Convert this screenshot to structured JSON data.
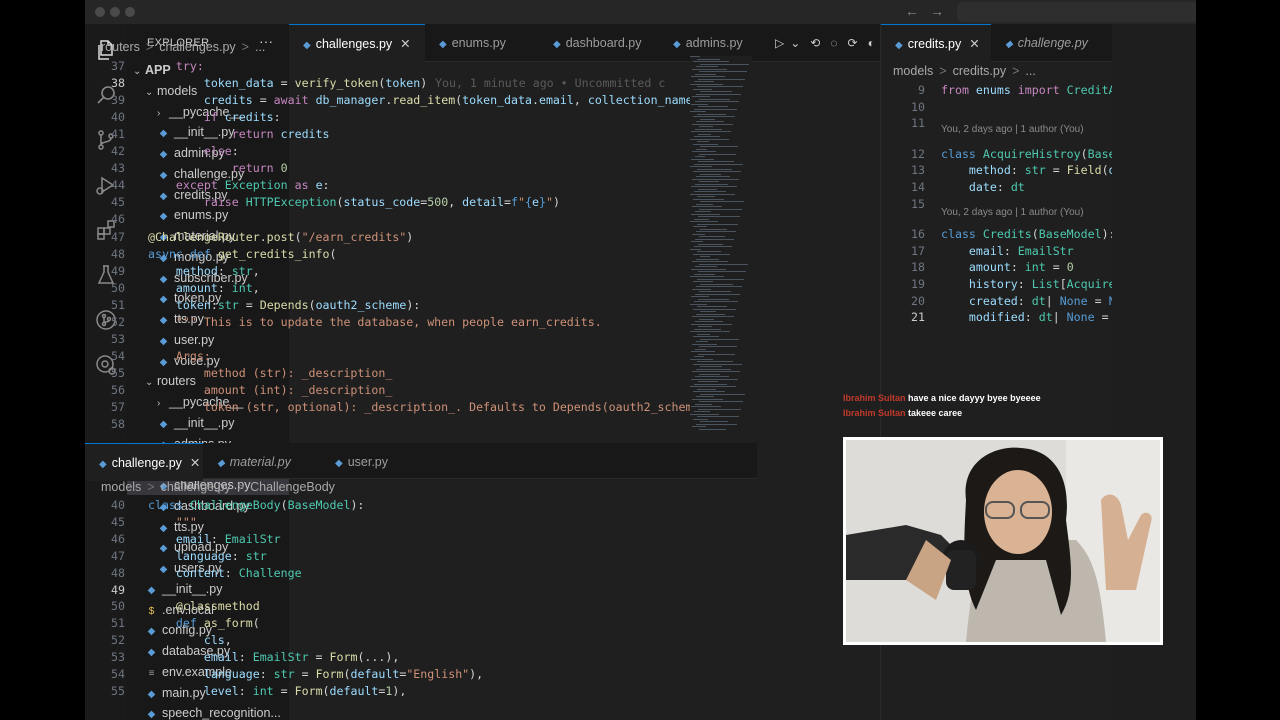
{
  "titlebar": {
    "back": "←",
    "forward": "→"
  },
  "activity_bar": {
    "icons": [
      "files-icon",
      "search-icon",
      "source-control-icon",
      "run-debug-icon",
      "extensions-icon",
      "testing-icon",
      "git-graph-icon",
      "remote-icon"
    ]
  },
  "sidebar": {
    "header": "EXPLORER",
    "more": "···",
    "items": [
      {
        "label": "APP",
        "kind": "folder",
        "depth": 0,
        "open": true
      },
      {
        "label": "models",
        "kind": "folder",
        "depth": 1,
        "open": true
      },
      {
        "label": "__pycache__",
        "kind": "folder",
        "depth": 2,
        "open": false
      },
      {
        "label": "__init__.py",
        "kind": "init",
        "depth": 2
      },
      {
        "label": "admin.py",
        "kind": "py",
        "depth": 2
      },
      {
        "label": "challenge.py",
        "kind": "py",
        "depth": 2
      },
      {
        "label": "credits.py",
        "kind": "py",
        "depth": 2
      },
      {
        "label": "enums.py",
        "kind": "py",
        "depth": 2
      },
      {
        "label": "material.py",
        "kind": "py",
        "depth": 2
      },
      {
        "label": "mongo.py",
        "kind": "py",
        "depth": 2
      },
      {
        "label": "subscriber.py",
        "kind": "py",
        "depth": 2
      },
      {
        "label": "token.py",
        "kind": "py",
        "depth": 2
      },
      {
        "label": "tts.py",
        "kind": "py",
        "depth": 2
      },
      {
        "label": "user.py",
        "kind": "py",
        "depth": 2
      },
      {
        "label": "voice.py",
        "kind": "py",
        "depth": 2
      },
      {
        "label": "routers",
        "kind": "folder",
        "depth": 1,
        "open": true
      },
      {
        "label": "__pycache__",
        "kind": "folder",
        "depth": 2,
        "open": false
      },
      {
        "label": "__init__.py",
        "kind": "init",
        "depth": 2
      },
      {
        "label": "admins.py",
        "kind": "py",
        "depth": 2
      },
      {
        "label": "auth.py",
        "kind": "py",
        "depth": 2
      },
      {
        "label": "challenges.py",
        "kind": "py",
        "depth": 2,
        "selected": true
      },
      {
        "label": "dashboard.py",
        "kind": "py",
        "depth": 2
      },
      {
        "label": "tts.py",
        "kind": "py",
        "depth": 2
      },
      {
        "label": "upload.py",
        "kind": "py",
        "depth": 2
      },
      {
        "label": "users.py",
        "kind": "py",
        "depth": 2
      },
      {
        "label": "__init__.py",
        "kind": "py",
        "depth": 1
      },
      {
        "label": ".env.local",
        "kind": "env",
        "depth": 1
      },
      {
        "label": "config.py",
        "kind": "py",
        "depth": 1
      },
      {
        "label": "database.py",
        "kind": "py",
        "depth": 1
      },
      {
        "label": "env.example",
        "kind": "ex",
        "depth": 1
      },
      {
        "label": "main.py",
        "kind": "py",
        "depth": 1
      },
      {
        "label": "speech_recognition...",
        "kind": "py",
        "depth": 1
      }
    ]
  },
  "top_editor": {
    "tabs": [
      {
        "label": "challenges.py",
        "active": true,
        "close": "✕"
      },
      {
        "label": "enums.py"
      },
      {
        "label": "dashboard.py"
      },
      {
        "label": "admins.py"
      }
    ],
    "breadcrumb": [
      "routers",
      ">",
      "challenges.py",
      ">",
      "..."
    ],
    "line_numbers": [
      "37",
      "38",
      "39",
      "40",
      "41",
      "42",
      "43",
      "44",
      "45",
      "46",
      "47",
      "48",
      "49",
      "50",
      "51",
      "52",
      "53",
      "54",
      "55",
      "56",
      "57",
      "58"
    ],
    "current_line": "38",
    "inline_blame": "You, 1 minute ago • Uncommitted c",
    "code": [
      [
        [
          "kw",
          "    try:"
        ]
      ],
      [
        [
          "",
          "        "
        ],
        [
          "var",
          "token_data"
        ],
        [
          "",
          " = "
        ],
        [
          "fn",
          "verify_token"
        ],
        [
          "",
          "("
        ],
        [
          "var",
          "token"
        ],
        [
          "",
          ")"
        ]
      ],
      [
        [
          "",
          "        "
        ],
        [
          "var",
          "credits"
        ],
        [
          "",
          " = "
        ],
        [
          "kw",
          "await"
        ],
        [
          "",
          " "
        ],
        [
          "var",
          "db_manager"
        ],
        [
          "",
          "."
        ],
        [
          "fn",
          "read_item"
        ],
        [
          "",
          "("
        ],
        [
          "var",
          "token_data"
        ],
        [
          "",
          "."
        ],
        [
          "var",
          "email"
        ],
        [
          "",
          ", "
        ],
        [
          "var",
          "collection_name"
        ],
        [
          "",
          "="
        ]
      ],
      [
        [
          "",
          "        "
        ],
        [
          "kw",
          "if"
        ],
        [
          "",
          " "
        ],
        [
          "var",
          "credits"
        ],
        [
          "",
          ":"
        ]
      ],
      [
        [
          "",
          "            "
        ],
        [
          "kw",
          "return"
        ],
        [
          "",
          " "
        ],
        [
          "var",
          "credits"
        ]
      ],
      [
        [
          "",
          "        "
        ],
        [
          "kw",
          "else"
        ],
        [
          "",
          ":"
        ]
      ],
      [
        [
          "",
          "            "
        ],
        [
          "kw",
          "return"
        ],
        [
          "",
          " "
        ],
        [
          "num",
          "0"
        ]
      ],
      [
        [
          "",
          "    "
        ],
        [
          "kw",
          "except"
        ],
        [
          "",
          " "
        ],
        [
          "cls2",
          "Exception"
        ],
        [
          "",
          " "
        ],
        [
          "kw",
          "as"
        ],
        [
          "",
          " "
        ],
        [
          "var",
          "e"
        ],
        [
          "",
          ":"
        ]
      ],
      [
        [
          "",
          "        "
        ],
        [
          "kw",
          "raise"
        ],
        [
          "",
          " "
        ],
        [
          "cls2",
          "HTTPException"
        ],
        [
          "",
          "("
        ],
        [
          "var",
          "status_code"
        ],
        [
          "",
          "="
        ],
        [
          "num",
          "500"
        ],
        [
          "",
          ", "
        ],
        [
          "var",
          "detail"
        ],
        [
          "",
          "="
        ],
        [
          "kb",
          "f"
        ],
        [
          "str",
          "\""
        ],
        [
          "kb",
          "{"
        ],
        [
          "var",
          "e"
        ],
        [
          "kb",
          "}"
        ],
        [
          "str",
          "\""
        ],
        [
          "",
          ")"
        ]
      ],
      [
        [
          "",
          ""
        ]
      ],
      [
        [
          "dec",
          "@ChallengeRouter"
        ],
        [
          "",
          "."
        ],
        [
          "fn",
          "post"
        ],
        [
          "",
          "("
        ],
        [
          "str",
          "\"/earn_credits\""
        ],
        [
          "",
          ")"
        ]
      ],
      [
        [
          "kb",
          "async"
        ],
        [
          "",
          " "
        ],
        [
          "kb",
          "def"
        ],
        [
          "",
          " "
        ],
        [
          "fn",
          "get_credits_info"
        ],
        [
          "",
          "("
        ]
      ],
      [
        [
          "",
          "    "
        ],
        [
          "var",
          "method"
        ],
        [
          "",
          ": "
        ],
        [
          "cls2",
          "str"
        ],
        [
          "",
          ","
        ]
      ],
      [
        [
          "",
          "    "
        ],
        [
          "var",
          "amount"
        ],
        [
          "",
          ": "
        ],
        [
          "cls2",
          "int"
        ],
        [
          "",
          ","
        ]
      ],
      [
        [
          "",
          "    "
        ],
        [
          "var",
          "token"
        ],
        [
          "",
          ":"
        ],
        [
          "cls2",
          "str"
        ],
        [
          "",
          " = "
        ],
        [
          "fn",
          "Depends"
        ],
        [
          "",
          "("
        ],
        [
          "var",
          "oauth2_scheme"
        ],
        [
          "",
          "):"
        ]
      ],
      [
        [
          "",
          "    "
        ],
        [
          "doc",
          "\"\"\" This is to update the database, when people earn_credits."
        ]
      ],
      [
        [
          "",
          ""
        ]
      ],
      [
        [
          "",
          "    "
        ],
        [
          "doc",
          "Args:"
        ]
      ],
      [
        [
          "",
          "        "
        ],
        [
          "doc",
          "method (str): _description_"
        ]
      ],
      [
        [
          "",
          "        "
        ],
        [
          "doc",
          "amount (int): _description_"
        ]
      ],
      [
        [
          "",
          "        "
        ],
        [
          "doc",
          "token (str, optional): _description_. Defaults to Depends(oauth2_scheme"
        ]
      ],
      [
        [
          "",
          ""
        ]
      ]
    ]
  },
  "bottom_editor": {
    "tabs": [
      {
        "label": "challenge.py",
        "active": true,
        "close": "✕"
      },
      {
        "label": "material.py",
        "italic": true
      },
      {
        "label": "user.py"
      }
    ],
    "breadcrumb": [
      "models",
      ">",
      "challenge.py",
      ">",
      "ChallengeBody"
    ],
    "line_numbers": [
      "40",
      "45",
      "46",
      "47",
      "48",
      "49",
      "50",
      "51",
      "52",
      "53",
      "54",
      "55"
    ],
    "current_line": "49",
    "code": [
      [
        [
          "kb",
          "class"
        ],
        [
          "",
          " "
        ],
        [
          "cls2",
          "ChallengeBody"
        ],
        [
          "",
          "("
        ],
        [
          "cls2",
          "BaseModel"
        ],
        [
          "",
          "):"
        ]
      ],
      [
        [
          "",
          "    "
        ],
        [
          "doc",
          "\"\"\""
        ]
      ],
      [
        [
          "",
          "    "
        ],
        [
          "var",
          "email"
        ],
        [
          "",
          ": "
        ],
        [
          "cls2",
          "EmailStr"
        ]
      ],
      [
        [
          "",
          "    "
        ],
        [
          "var",
          "language"
        ],
        [
          "",
          ": "
        ],
        [
          "cls2",
          "str"
        ]
      ],
      [
        [
          "",
          "    "
        ],
        [
          "var",
          "content"
        ],
        [
          "",
          ": "
        ],
        [
          "cls2",
          "Challenge"
        ]
      ],
      [
        [
          "",
          ""
        ]
      ],
      [
        [
          "",
          "    "
        ],
        [
          "dec",
          "@classmethod"
        ]
      ],
      [
        [
          "",
          "    "
        ],
        [
          "kb",
          "def"
        ],
        [
          "",
          " "
        ],
        [
          "fn",
          "as_form"
        ],
        [
          "",
          "("
        ]
      ],
      [
        [
          "",
          "        "
        ],
        [
          "var",
          "cls"
        ],
        [
          "",
          ","
        ]
      ],
      [
        [
          "",
          "        "
        ],
        [
          "var",
          "email"
        ],
        [
          "",
          ": "
        ],
        [
          "cls2",
          "EmailStr"
        ],
        [
          "",
          " = "
        ],
        [
          "fn",
          "Form"
        ],
        [
          "",
          "(...),"
        ]
      ],
      [
        [
          "",
          "        "
        ],
        [
          "var",
          "language"
        ],
        [
          "",
          ": "
        ],
        [
          "cls2",
          "str"
        ],
        [
          "",
          " = "
        ],
        [
          "fn",
          "Form"
        ],
        [
          "",
          "("
        ],
        [
          "var",
          "default"
        ],
        [
          "",
          "="
        ],
        [
          "str",
          "\"English\""
        ],
        [
          "",
          "),"
        ]
      ],
      [
        [
          "",
          "        "
        ],
        [
          "var",
          "level"
        ],
        [
          "",
          ": "
        ],
        [
          "cls2",
          "int"
        ],
        [
          "",
          " = "
        ],
        [
          "fn",
          "Form"
        ],
        [
          "",
          "("
        ],
        [
          "var",
          "default"
        ],
        [
          "",
          "="
        ],
        [
          "num",
          "1"
        ],
        [
          "",
          "),"
        ]
      ]
    ]
  },
  "right_editor": {
    "tabs": [
      {
        "label": "credits.py",
        "active": true,
        "close": "✕"
      },
      {
        "label": "challenge.py",
        "italic": true
      }
    ],
    "breadcrumb": [
      "models",
      ">",
      "credits.py",
      ">",
      "..."
    ],
    "line_numbers": [
      "9",
      "10",
      "11",
      "12",
      "13",
      "14",
      "15",
      "16",
      "17",
      "18",
      "19",
      "20",
      "21"
    ],
    "current_line": "21",
    "blame_1": "You, 2 days ago | 1 author (You)",
    "blame_2": "You, 2 days ago | 1 author (You)",
    "code": [
      [
        [
          "kw",
          "from"
        ],
        [
          "",
          " "
        ],
        [
          "var",
          "enums"
        ],
        [
          "",
          " "
        ],
        [
          "kw",
          "import"
        ],
        [
          "",
          " "
        ],
        [
          "cls2",
          "CreditA"
        ]
      ],
      [
        [
          "",
          ""
        ]
      ],
      [
        [
          "",
          ""
        ]
      ],
      [
        [
          "kb",
          "class"
        ],
        [
          "",
          " "
        ],
        [
          "cls2",
          "AcquireHistroy"
        ],
        [
          "",
          "("
        ],
        [
          "cls2",
          "Base"
        ]
      ],
      [
        [
          "",
          "    "
        ],
        [
          "var",
          "method"
        ],
        [
          "",
          ": "
        ],
        [
          "cls2",
          "str"
        ],
        [
          "",
          " = "
        ],
        [
          "fn",
          "Field"
        ],
        [
          "",
          "("
        ],
        [
          "var",
          "d"
        ]
      ],
      [
        [
          "",
          "    "
        ],
        [
          "var",
          "date"
        ],
        [
          "",
          ": "
        ],
        [
          "cls2",
          "dt"
        ]
      ],
      [
        [
          "",
          ""
        ]
      ],
      [
        [
          "kb",
          "class"
        ],
        [
          "",
          " "
        ],
        [
          "cls2",
          "Credits"
        ],
        [
          "",
          "("
        ],
        [
          "cls2",
          "BaseModel"
        ],
        [
          "",
          "):"
        ]
      ],
      [
        [
          "",
          "    "
        ],
        [
          "var",
          "email"
        ],
        [
          "",
          ": "
        ],
        [
          "cls2",
          "EmailStr"
        ]
      ],
      [
        [
          "",
          "    "
        ],
        [
          "var",
          "amount"
        ],
        [
          "",
          ": "
        ],
        [
          "cls2",
          "int"
        ],
        [
          "",
          " = "
        ],
        [
          "num",
          "0"
        ]
      ],
      [
        [
          "",
          "    "
        ],
        [
          "var",
          "history"
        ],
        [
          "",
          ": "
        ],
        [
          "cls2",
          "List"
        ],
        [
          "",
          "["
        ],
        [
          "cls2",
          "Acquire"
        ]
      ],
      [
        [
          "",
          "    "
        ],
        [
          "var",
          "created"
        ],
        [
          "",
          ": "
        ],
        [
          "cls2",
          "dt"
        ],
        [
          "",
          "| "
        ],
        [
          "kb",
          "None"
        ],
        [
          "",
          " = "
        ],
        [
          "kb",
          "N"
        ]
      ],
      [
        [
          "",
          "    "
        ],
        [
          "var",
          "modified"
        ],
        [
          "",
          ": "
        ],
        [
          "cls2",
          "dt"
        ],
        [
          "",
          "| "
        ],
        [
          "kb",
          "None"
        ],
        [
          "",
          " = "
        ]
      ]
    ]
  },
  "chat": [
    {
      "user": "Ibrahim Sultan",
      "message": "have a nice dayyy byee byeeee"
    },
    {
      "user": "Ibrahim Sultan",
      "message": "takeee caree"
    }
  ],
  "colors": {
    "accent": "#0078d4",
    "python": "#5a9bd6",
    "chat_user": "#c0392b"
  }
}
